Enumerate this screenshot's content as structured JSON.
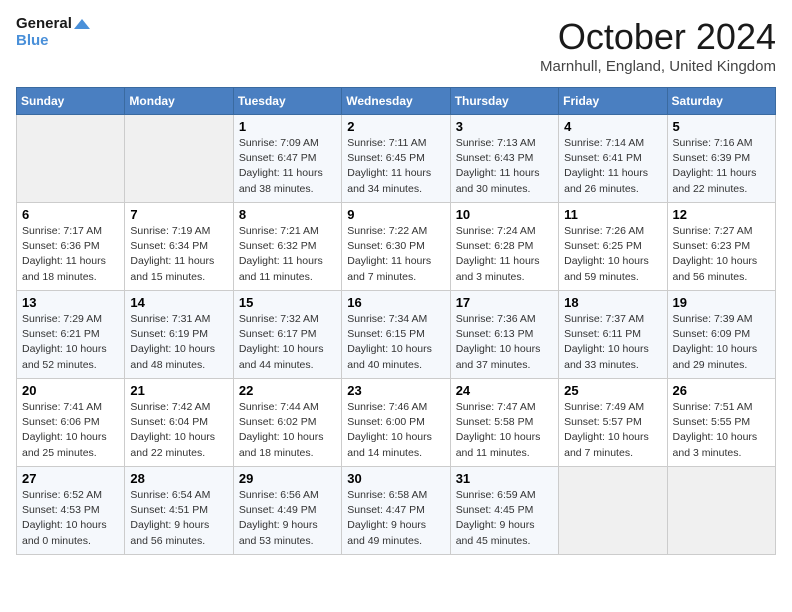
{
  "logo": {
    "line1": "General",
    "line2": "Blue"
  },
  "title": "October 2024",
  "location": "Marnhull, England, United Kingdom",
  "days_of_week": [
    "Sunday",
    "Monday",
    "Tuesday",
    "Wednesday",
    "Thursday",
    "Friday",
    "Saturday"
  ],
  "weeks": [
    [
      {
        "day": "",
        "detail": ""
      },
      {
        "day": "",
        "detail": ""
      },
      {
        "day": "1",
        "detail": "Sunrise: 7:09 AM\nSunset: 6:47 PM\nDaylight: 11 hours and 38 minutes."
      },
      {
        "day": "2",
        "detail": "Sunrise: 7:11 AM\nSunset: 6:45 PM\nDaylight: 11 hours and 34 minutes."
      },
      {
        "day": "3",
        "detail": "Sunrise: 7:13 AM\nSunset: 6:43 PM\nDaylight: 11 hours and 30 minutes."
      },
      {
        "day": "4",
        "detail": "Sunrise: 7:14 AM\nSunset: 6:41 PM\nDaylight: 11 hours and 26 minutes."
      },
      {
        "day": "5",
        "detail": "Sunrise: 7:16 AM\nSunset: 6:39 PM\nDaylight: 11 hours and 22 minutes."
      }
    ],
    [
      {
        "day": "6",
        "detail": "Sunrise: 7:17 AM\nSunset: 6:36 PM\nDaylight: 11 hours and 18 minutes."
      },
      {
        "day": "7",
        "detail": "Sunrise: 7:19 AM\nSunset: 6:34 PM\nDaylight: 11 hours and 15 minutes."
      },
      {
        "day": "8",
        "detail": "Sunrise: 7:21 AM\nSunset: 6:32 PM\nDaylight: 11 hours and 11 minutes."
      },
      {
        "day": "9",
        "detail": "Sunrise: 7:22 AM\nSunset: 6:30 PM\nDaylight: 11 hours and 7 minutes."
      },
      {
        "day": "10",
        "detail": "Sunrise: 7:24 AM\nSunset: 6:28 PM\nDaylight: 11 hours and 3 minutes."
      },
      {
        "day": "11",
        "detail": "Sunrise: 7:26 AM\nSunset: 6:25 PM\nDaylight: 10 hours and 59 minutes."
      },
      {
        "day": "12",
        "detail": "Sunrise: 7:27 AM\nSunset: 6:23 PM\nDaylight: 10 hours and 56 minutes."
      }
    ],
    [
      {
        "day": "13",
        "detail": "Sunrise: 7:29 AM\nSunset: 6:21 PM\nDaylight: 10 hours and 52 minutes."
      },
      {
        "day": "14",
        "detail": "Sunrise: 7:31 AM\nSunset: 6:19 PM\nDaylight: 10 hours and 48 minutes."
      },
      {
        "day": "15",
        "detail": "Sunrise: 7:32 AM\nSunset: 6:17 PM\nDaylight: 10 hours and 44 minutes."
      },
      {
        "day": "16",
        "detail": "Sunrise: 7:34 AM\nSunset: 6:15 PM\nDaylight: 10 hours and 40 minutes."
      },
      {
        "day": "17",
        "detail": "Sunrise: 7:36 AM\nSunset: 6:13 PM\nDaylight: 10 hours and 37 minutes."
      },
      {
        "day": "18",
        "detail": "Sunrise: 7:37 AM\nSunset: 6:11 PM\nDaylight: 10 hours and 33 minutes."
      },
      {
        "day": "19",
        "detail": "Sunrise: 7:39 AM\nSunset: 6:09 PM\nDaylight: 10 hours and 29 minutes."
      }
    ],
    [
      {
        "day": "20",
        "detail": "Sunrise: 7:41 AM\nSunset: 6:06 PM\nDaylight: 10 hours and 25 minutes."
      },
      {
        "day": "21",
        "detail": "Sunrise: 7:42 AM\nSunset: 6:04 PM\nDaylight: 10 hours and 22 minutes."
      },
      {
        "day": "22",
        "detail": "Sunrise: 7:44 AM\nSunset: 6:02 PM\nDaylight: 10 hours and 18 minutes."
      },
      {
        "day": "23",
        "detail": "Sunrise: 7:46 AM\nSunset: 6:00 PM\nDaylight: 10 hours and 14 minutes."
      },
      {
        "day": "24",
        "detail": "Sunrise: 7:47 AM\nSunset: 5:58 PM\nDaylight: 10 hours and 11 minutes."
      },
      {
        "day": "25",
        "detail": "Sunrise: 7:49 AM\nSunset: 5:57 PM\nDaylight: 10 hours and 7 minutes."
      },
      {
        "day": "26",
        "detail": "Sunrise: 7:51 AM\nSunset: 5:55 PM\nDaylight: 10 hours and 3 minutes."
      }
    ],
    [
      {
        "day": "27",
        "detail": "Sunrise: 6:52 AM\nSunset: 4:53 PM\nDaylight: 10 hours and 0 minutes."
      },
      {
        "day": "28",
        "detail": "Sunrise: 6:54 AM\nSunset: 4:51 PM\nDaylight: 9 hours and 56 minutes."
      },
      {
        "day": "29",
        "detail": "Sunrise: 6:56 AM\nSunset: 4:49 PM\nDaylight: 9 hours and 53 minutes."
      },
      {
        "day": "30",
        "detail": "Sunrise: 6:58 AM\nSunset: 4:47 PM\nDaylight: 9 hours and 49 minutes."
      },
      {
        "day": "31",
        "detail": "Sunrise: 6:59 AM\nSunset: 4:45 PM\nDaylight: 9 hours and 45 minutes."
      },
      {
        "day": "",
        "detail": ""
      },
      {
        "day": "",
        "detail": ""
      }
    ]
  ]
}
